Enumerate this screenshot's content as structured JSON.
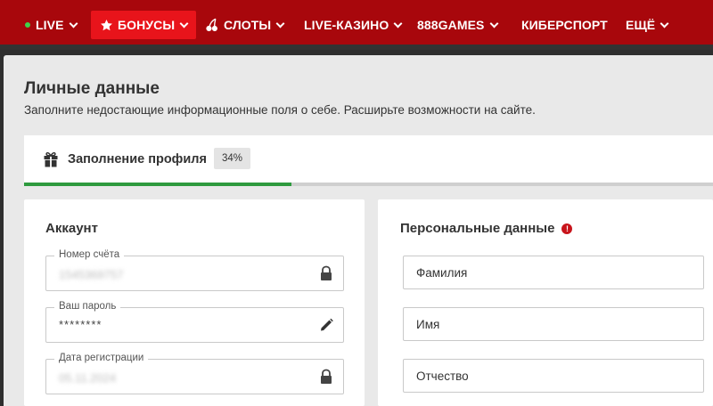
{
  "nav": {
    "items": [
      {
        "label": "LIVE"
      },
      {
        "label": "БОНУСЫ"
      },
      {
        "label": "СЛОТЫ"
      },
      {
        "label": "LIVE-КАЗИНО"
      },
      {
        "label": "888GAMES"
      },
      {
        "label": "КИБЕРСПОРТ"
      },
      {
        "label": "ЕЩЁ"
      }
    ]
  },
  "page": {
    "title": "Личные данные",
    "subtitle": "Заполните недостающие информационные поля о себе. Расширьте возможности на сайте."
  },
  "profile_progress": {
    "label": "Заполнение профиля",
    "percent_label": "34%",
    "fraction": 0.34
  },
  "account": {
    "title": "Аккаунт",
    "fields": [
      {
        "label": "Номер счёта",
        "value": "1545369757"
      },
      {
        "label": "Ваш пароль",
        "value": "********"
      },
      {
        "label": "Дата регистрации",
        "value": "05.11.2024"
      }
    ]
  },
  "personal": {
    "title": "Персональные данные",
    "fields": [
      {
        "placeholder": "Фамилия"
      },
      {
        "placeholder": "Имя"
      },
      {
        "placeholder": "Отчество"
      }
    ]
  },
  "colors": {
    "nav_bg": "#a8070c",
    "nav_active": "#e8141b",
    "progress": "#2e9a3e",
    "warning": "#c8141b"
  },
  "icons": {
    "live": "live-dot-icon",
    "bonus": "star-icon",
    "slots": "cherry-icon",
    "profile": "gift-icon",
    "account_number": "lock-icon",
    "password": "pencil-icon",
    "registration_date": "lock-icon",
    "personal_warning": "exclamation-icon"
  }
}
